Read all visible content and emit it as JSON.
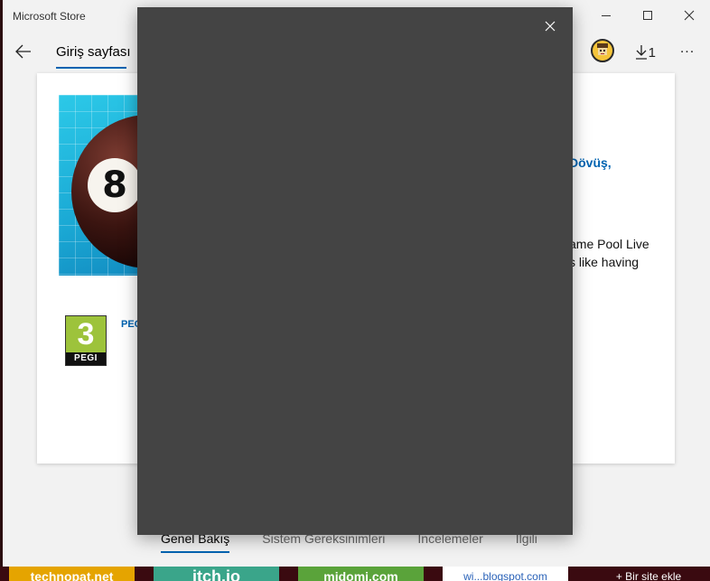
{
  "window": {
    "app_title": "Microsoft Store"
  },
  "nav": {
    "home_label": "Giriş sayfası",
    "downloads_count": "1",
    "more_label": "..."
  },
  "product": {
    "image_number": "8",
    "category_partial": "Dövüş,",
    "description_line1": "ame Pool Live",
    "description_line2": "s like having",
    "rating_badge": {
      "number": "3",
      "label": "PEGI"
    },
    "rating_link_partial": "PEG"
  },
  "tabs": [
    {
      "label": "Genel Bakış",
      "active": true
    },
    {
      "label": "Sistem Gereksinimleri",
      "active": false
    },
    {
      "label": "İncelemeler",
      "active": false
    },
    {
      "label": "İlgili",
      "active": false
    }
  ],
  "background_tiles": [
    {
      "label": "technopat.net"
    },
    {
      "label": "itch.io"
    },
    {
      "label": "midomi.com"
    },
    {
      "label": "wi...blogspot.com"
    },
    {
      "label": "+ Bir site ekle"
    }
  ],
  "colors": {
    "accent": "#0063b1",
    "modal_background": "#444444",
    "pegi_green": "#9dc33b"
  },
  "icons": {
    "back": "arrow-left",
    "download": "download-arrow",
    "close": "x-mark",
    "minimize": "minus",
    "maximize": "square"
  }
}
